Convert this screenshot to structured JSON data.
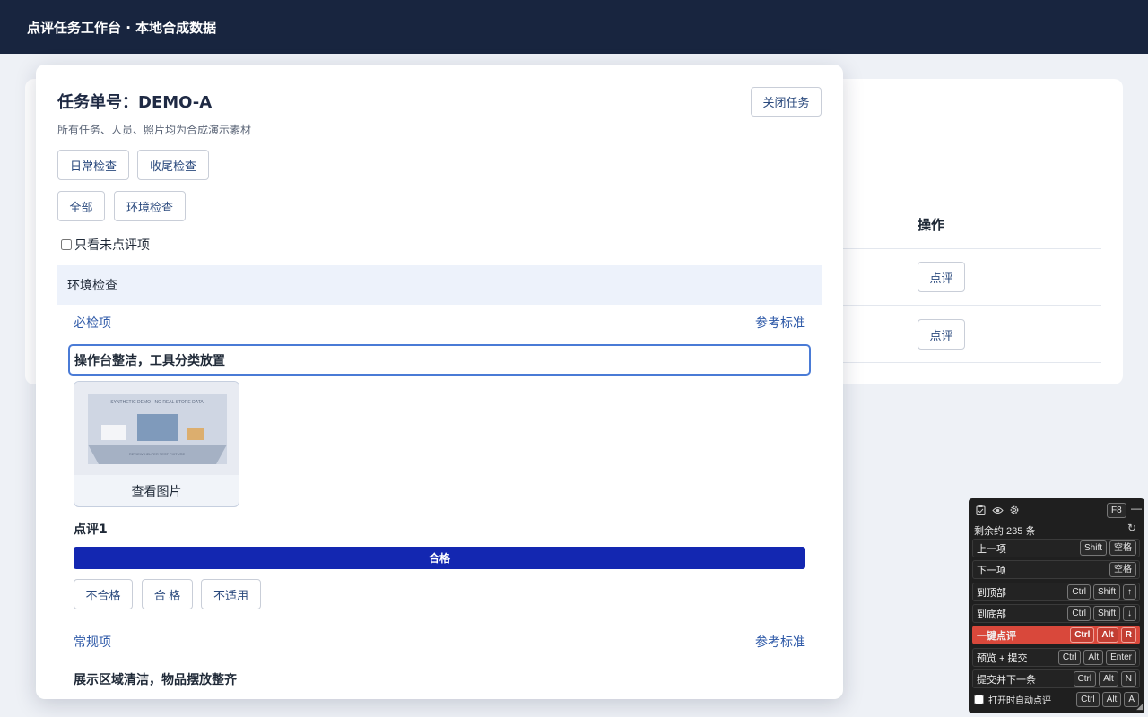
{
  "header": {
    "title": "点评任务工作台 · 本地合成数据"
  },
  "background": {
    "op_header": "操作",
    "row_buttons": [
      "点评",
      "点评"
    ]
  },
  "modal": {
    "title": "任务单号：DEMO-A",
    "subtitle": "所有任务、人员、照片均为合成演示素材",
    "close_label": "关闭任务",
    "check_types": [
      "日常检查",
      "收尾检查"
    ],
    "filters": [
      "全部",
      "环境检查"
    ],
    "only_unreviewed_label": "只看未点评项",
    "section_title": "环境检查",
    "group1": {
      "label": "必检项",
      "ref_label": "参考标准"
    },
    "item1": {
      "title": "操作台整洁，工具分类放置",
      "photo_caption_top": "SYNTHETIC DEMO · NO REAL STORE DATA",
      "photo_caption_bottom": "REVIEW HELPER TEST FIXTURE",
      "view_photo_label": "查看图片",
      "review_label": "点评1",
      "result": "合格",
      "options": [
        "不合格",
        "合 格",
        "不适用"
      ]
    },
    "group2": {
      "label": "常规项",
      "ref_label": "参考标准"
    },
    "item2": {
      "title": "展示区域清洁，物品摆放整齐"
    }
  },
  "shortcut_panel": {
    "hotkey": "F8",
    "remaining": "剩余约 235 条",
    "rows": [
      {
        "label": "上一项",
        "keys": [
          "Shift",
          "空格"
        ],
        "highlight": false
      },
      {
        "label": "下一项",
        "keys": [
          "空格"
        ],
        "highlight": false
      },
      {
        "label": "到顶部",
        "keys": [
          "Ctrl",
          "Shift",
          "↑"
        ],
        "highlight": false
      },
      {
        "label": "到底部",
        "keys": [
          "Ctrl",
          "Shift",
          "↓"
        ],
        "highlight": false
      },
      {
        "label": "一键点评",
        "keys": [
          "Ctrl",
          "Alt",
          "R"
        ],
        "highlight": true
      },
      {
        "label": "预览 + 提交",
        "keys": [
          "Ctrl",
          "Alt",
          "Enter"
        ],
        "highlight": false
      },
      {
        "label": "提交并下一条",
        "keys": [
          "Ctrl",
          "Alt",
          "N"
        ],
        "highlight": false
      }
    ],
    "auto_label": "打开时自动点评",
    "auto_keys": [
      "Ctrl",
      "Alt",
      "A"
    ],
    "icons": [
      "clipboard-icon",
      "eye-icon",
      "gear-icon",
      "minimize-icon",
      "refresh-icon"
    ]
  },
  "colors": {
    "header_bg": "#18253f",
    "pass_bar": "#1327b1",
    "hot_row": "#d9483b",
    "link": "#2f5aa8"
  }
}
